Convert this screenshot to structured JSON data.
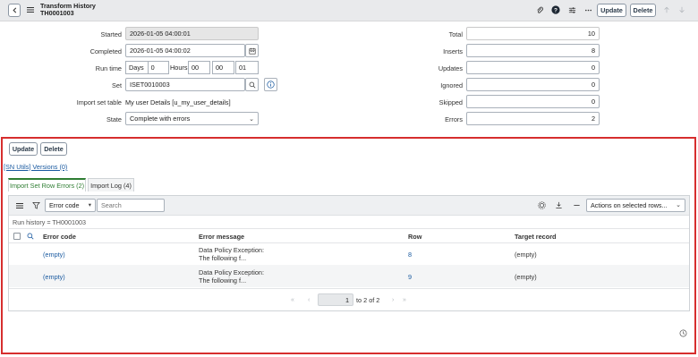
{
  "header": {
    "title": "Transform History",
    "subtitle": "TH0001003",
    "update_label": "Update",
    "delete_label": "Delete"
  },
  "form": {
    "started_label": "Started",
    "started_value": "2026-01-05 04:00:01",
    "completed_label": "Completed",
    "completed_value": "2026-01-05 04:00:02",
    "runtime_label": "Run time",
    "days_label": "Days",
    "days_value": "0",
    "hours_label": "Hours",
    "hours_value": "00",
    "minutes_value": "00",
    "seconds_value": "01",
    "set_label": "Set",
    "set_value": "ISET0010003",
    "import_table_label": "Import set table",
    "import_table_value": "My user Details [u_my_user_details]",
    "state_label": "State",
    "state_value": "Complete with errors",
    "total_label": "Total",
    "total_value": "10",
    "inserts_label": "Inserts",
    "inserts_value": "8",
    "updates_label": "Updates",
    "updates_value": "0",
    "ignored_label": "Ignored",
    "ignored_value": "0",
    "skipped_label": "Skipped",
    "skipped_value": "0",
    "errors_label": "Errors",
    "errors_value": "2"
  },
  "related": {
    "update_label": "Update",
    "delete_label": "Delete",
    "versions_link": "[SN Utils] Versions (0)",
    "tabs": [
      {
        "label": "Import Set Row Errors (2)"
      },
      {
        "label": "Import Log (4)"
      }
    ],
    "filter_field": "Error code",
    "search_placeholder": "Search",
    "actions_label": "Actions on selected rows...",
    "breadcrumb": "Run history = TH0001003",
    "columns": [
      "Error code",
      "Error message",
      "Row",
      "Target record"
    ],
    "rows": [
      {
        "error_code": "(empty)",
        "message_line1": "Data Policy Exception:",
        "message_line2": "The following f...",
        "row": "8",
        "target": "(empty)"
      },
      {
        "error_code": "(empty)",
        "message_line1": "Data Policy Exception:",
        "message_line2": "The following f...",
        "row": "9",
        "target": "(empty)"
      }
    ],
    "pager": {
      "current": "1",
      "range_text": "to 2 of 2"
    }
  },
  "colors": {
    "accent_green": "#2e7d32",
    "link_blue": "#1a5aa0",
    "highlight_red": "#d62e2e"
  }
}
